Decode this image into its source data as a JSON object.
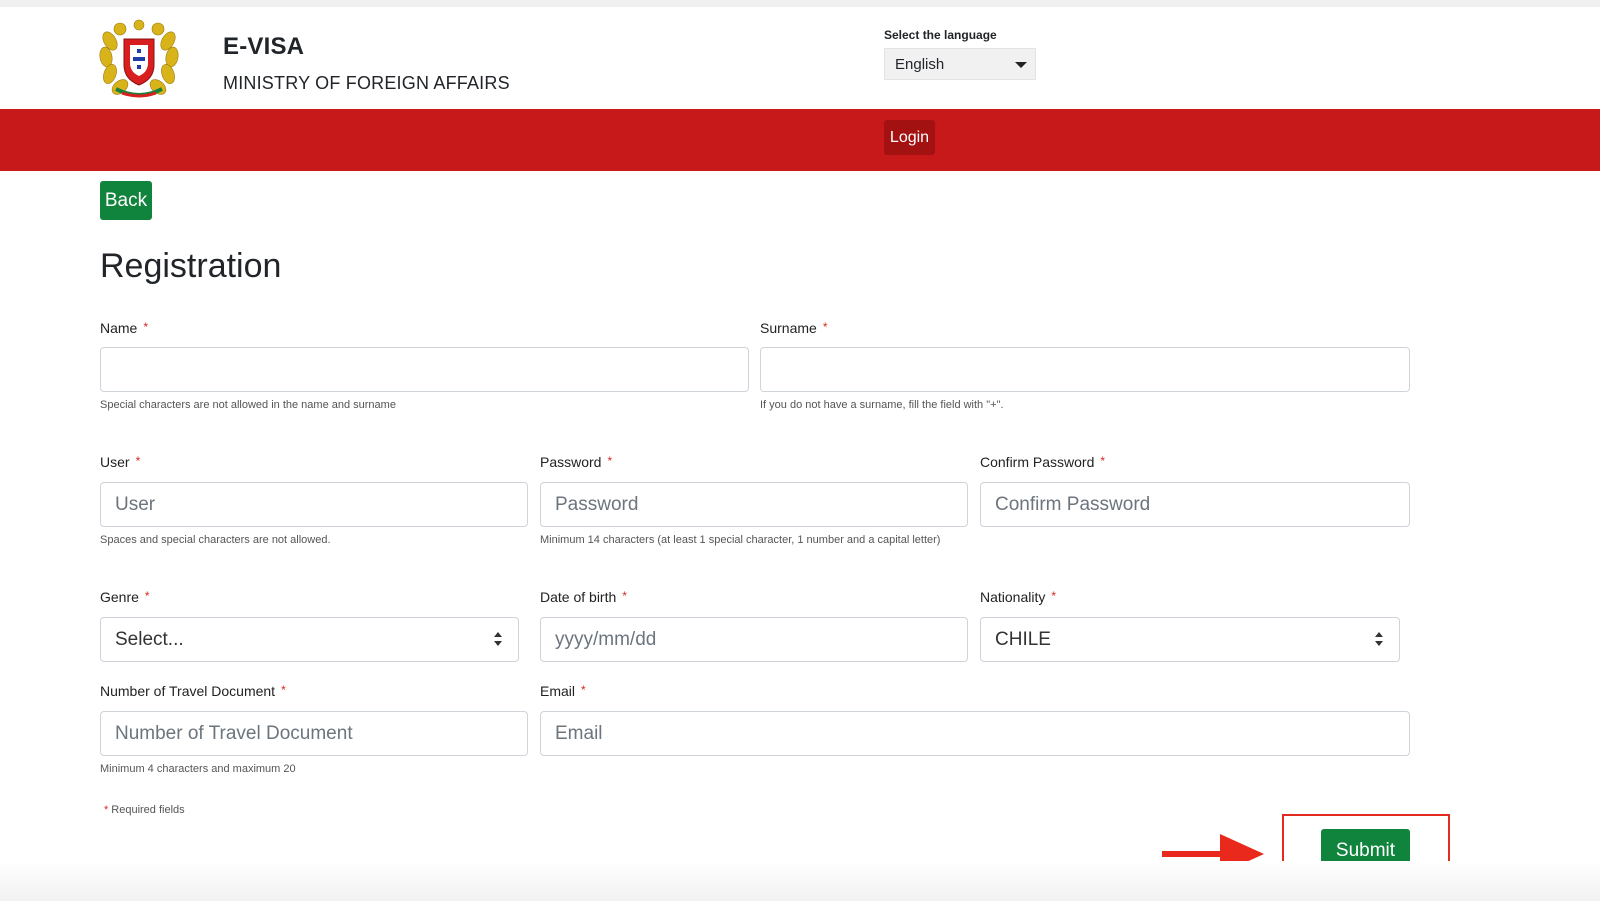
{
  "header": {
    "title": "E-VISA",
    "subtitle": "MINISTRY OF FOREIGN AFFAIRS",
    "language_label": "Select the language",
    "language_value": "English"
  },
  "nav": {
    "login_label": "Login"
  },
  "back_label": "Back",
  "page_title": "Registration",
  "required_marker": "*",
  "fields": {
    "name": {
      "label": "Name",
      "value": "",
      "help": "Special characters are not allowed in the name and surname"
    },
    "surname": {
      "label": "Surname",
      "value": "",
      "help": "If you do not have a surname, fill the field with \"+\"."
    },
    "user": {
      "label": "User",
      "placeholder": "User",
      "help": "Spaces and special characters are not allowed."
    },
    "password": {
      "label": "Password",
      "placeholder": "Password",
      "help": "Minimum 14 characters (at least 1 special character, 1 number and a capital letter)"
    },
    "confirm_password": {
      "label": "Confirm Password",
      "placeholder": "Confirm Password"
    },
    "genre": {
      "label": "Genre",
      "value": "Select..."
    },
    "date_of_birth": {
      "label": "Date of birth",
      "placeholder": "yyyy/mm/dd"
    },
    "nationality": {
      "label": "Nationality",
      "value": "CHILE"
    },
    "travel_document": {
      "label": "Number of Travel Document",
      "placeholder": "Number of Travel Document",
      "help": "Minimum 4 characters and maximum 20"
    },
    "email": {
      "label": "Email",
      "placeholder": "Email"
    }
  },
  "required_fields_note": "Required fields",
  "submit_label": "Submit",
  "colors": {
    "header_red": "#c8191a",
    "login_red": "#a31111",
    "button_green": "#10833c",
    "required_star": "#d9261c",
    "annotation_red": "#e32b20"
  },
  "icons": [
    "coat-of-arms-logo",
    "caret-down-icon",
    "select-updown-icon",
    "annotation-arrow"
  ]
}
